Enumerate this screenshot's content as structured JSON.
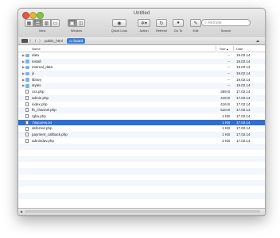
{
  "window": {
    "title": "Untitled"
  },
  "toolbar": {
    "view_label": "View",
    "window_label": "Window",
    "quicklook_label": "Quick Look",
    "action_label": "Action",
    "refresh_label": "Refresh",
    "goto_label": "Go To",
    "edit_label": "Edit",
    "search_label": "Search",
    "search_placeholder": "Remote"
  },
  "pathbar": {
    "items": [
      "/",
      "public_html",
      "board"
    ]
  },
  "columns": {
    "name": "Name",
    "size": "Size",
    "date": "Date"
  },
  "files": [
    {
      "name": "data",
      "size": "--",
      "date": "19.02.14",
      "type": "folder"
    },
    {
      "name": "install",
      "size": "--",
      "date": "19.02.14",
      "type": "folder"
    },
    {
      "name": "internal_data",
      "size": "--",
      "date": "19.02.14",
      "type": "folder"
    },
    {
      "name": "js",
      "size": "--",
      "date": "19.02.14",
      "type": "folder"
    },
    {
      "name": "library",
      "size": "--",
      "date": "19.02.14",
      "type": "folder"
    },
    {
      "name": "styles",
      "size": "--",
      "date": "19.02.14",
      "type": "folder"
    },
    {
      "name": "css.php",
      "size": "359 B",
      "date": "17.02.14",
      "type": "file"
    },
    {
      "name": "admin.php",
      "size": "415 B",
      "date": "17.02.14",
      "type": "file"
    },
    {
      "name": "index.php",
      "size": "416 B",
      "date": "17.02.14",
      "type": "file"
    },
    {
      "name": "fb_channel.php",
      "size": "510 B",
      "date": "17.02.14",
      "type": "file"
    },
    {
      "name": "rgba.php",
      "size": "1 KB",
      "date": "17.02.14",
      "type": "file"
    },
    {
      "name": ".htaccess.txt",
      "size": "1 KB",
      "date": "17.02.14",
      "type": "file",
      "selected": true
    },
    {
      "name": "deferred.php",
      "size": "1 KB",
      "date": "17.02.14",
      "type": "file"
    },
    {
      "name": "payment_callback.php",
      "size": "1 KB",
      "date": "17.02.14",
      "type": "file"
    },
    {
      "name": "admindav.php",
      "size": "2 KB",
      "date": "17.02.14",
      "type": "file"
    }
  ]
}
